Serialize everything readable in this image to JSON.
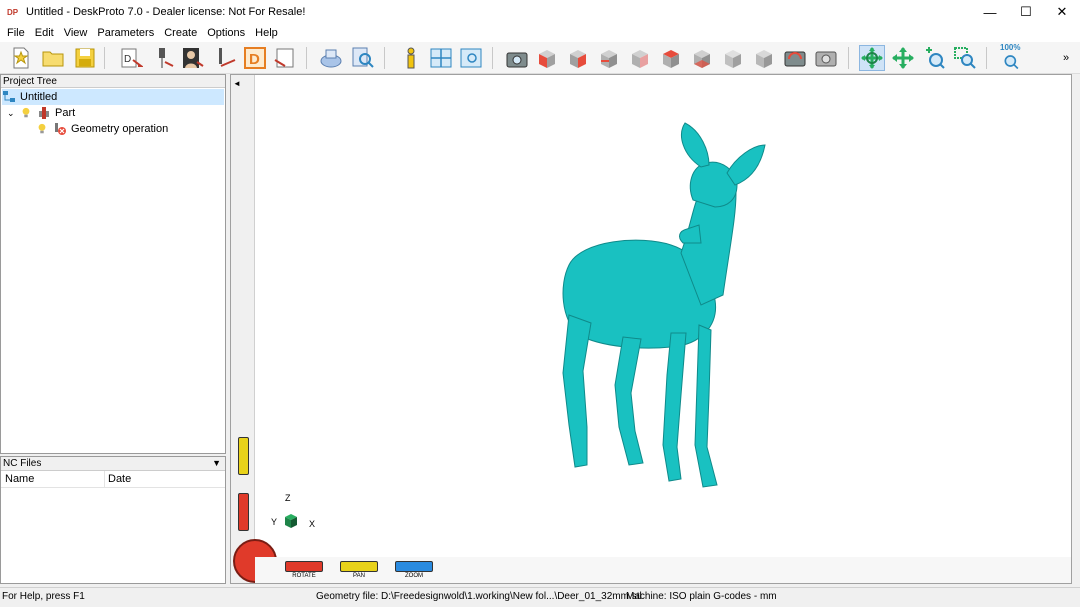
{
  "window": {
    "title": "Untitled - DeskProto 7.0 - Dealer license: Not For Resale!",
    "controls": {
      "minimize": "—",
      "maximize": "☐",
      "close": "✕"
    }
  },
  "menu": [
    "File",
    "Edit",
    "View",
    "Parameters",
    "Create",
    "Options",
    "Help"
  ],
  "toolbar": {
    "zoom_label": "100%",
    "buttons": [
      "new-project",
      "open-project",
      "save-project",
      "import-geometry",
      "tool-parameters",
      "part-image",
      "edit-vector",
      "drawing-tool",
      "tool-d",
      "export-geometry",
      "print",
      "find",
      "info",
      "layout-view",
      "zoom-window",
      "camera",
      "view-front",
      "view-back",
      "view-left",
      "view-right",
      "view-top",
      "view-bottom",
      "view-iso",
      "view-iso-2",
      "camera-rotate",
      "camera-reset",
      "rotate-mode",
      "pan-mode",
      "zoom-in-mode",
      "zoom-box-mode",
      "zoom-100"
    ]
  },
  "project_tree": {
    "header": "Project Tree",
    "items": [
      {
        "label": "Untitled",
        "selected": true
      },
      {
        "label": "Part"
      },
      {
        "label": "Geometry operation"
      }
    ]
  },
  "nc_files": {
    "header": "NC Files",
    "columns": [
      "Name",
      "Date"
    ]
  },
  "viewport": {
    "axes": {
      "z": "Z",
      "y": "Y",
      "x": "X"
    },
    "nav": [
      {
        "label": "ROTATE",
        "color": "#e03a2a"
      },
      {
        "label": "PAN",
        "color": "#e8d21a"
      },
      {
        "label": "ZOOM",
        "color": "#2a8be0"
      }
    ],
    "model_color": "#19c1c1"
  },
  "status": {
    "help": "For Help, press F1",
    "geometry": "Geometry file: D:\\Freedesignwold\\1.working\\New fol...\\Deer_01_32mm.stl",
    "machine": "Machine: ISO plain G-codes - mm"
  }
}
